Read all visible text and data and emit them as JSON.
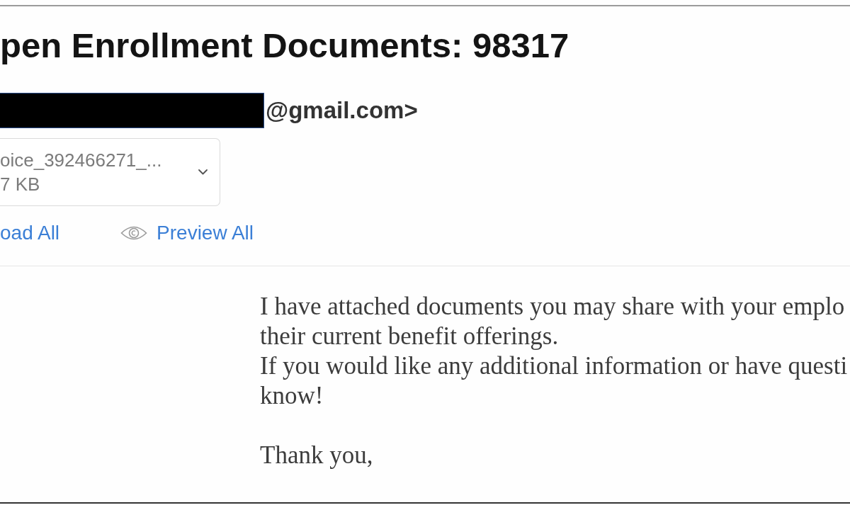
{
  "message": {
    "subject": "pen Enrollment Documents: 98317",
    "sender": {
      "redacted": true,
      "address": "@gmail.com>"
    },
    "attachment": {
      "name": "oice_392466271_...",
      "size": "7 KB"
    },
    "actions": [
      {
        "kind": "download",
        "label": "oad All"
      },
      {
        "kind": "preview",
        "label": "Preview All"
      }
    ],
    "body": [
      {
        "sentences": [
          {
            "lines": [
              "I have attached documents you may share with your emplo",
              "their current benefit offerings."
            ]
          },
          {
            "lines": [
              "If you would like any additional information or have questi",
              "know!"
            ]
          }
        ]
      },
      {
        "sentences": [
          {
            "lines": [
              "Thank you,"
            ]
          }
        ]
      }
    ]
  }
}
